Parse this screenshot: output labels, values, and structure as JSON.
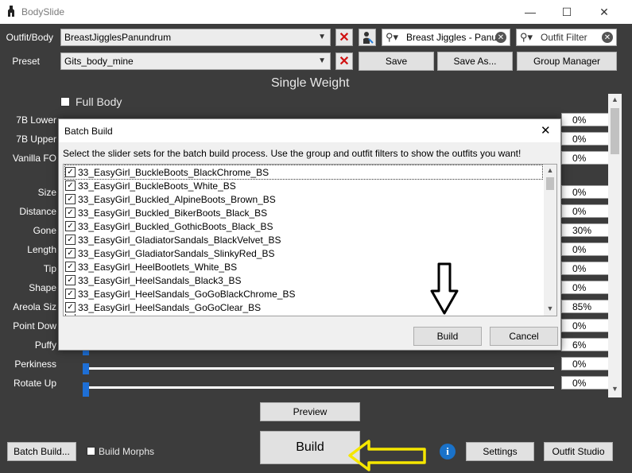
{
  "window": {
    "title": "BodySlide",
    "minimize": "—",
    "maximize": "☐",
    "close": "✕"
  },
  "outfit": {
    "label": "Outfit/Body",
    "value": "BreastJigglesPanundrum"
  },
  "preset": {
    "label": "Preset",
    "value": "Gits_body_mine"
  },
  "group_filter": {
    "value": "Breast Jiggles - Panu"
  },
  "outfit_filter": {
    "placeholder": "Outfit Filter"
  },
  "buttons": {
    "save": "Save",
    "save_as": "Save As...",
    "group_manager": "Group Manager",
    "preview": "Preview",
    "build": "Build",
    "batch_build": "Batch Build...",
    "settings": "Settings",
    "outfit_studio": "Outfit Studio"
  },
  "build_morphs": {
    "label": "Build Morphs",
    "checked": false
  },
  "weight_title": "Single Weight",
  "full_body": {
    "label": "Full Body",
    "checked": true
  },
  "sliders": [
    {
      "label": "7B Lower",
      "value": "0%"
    },
    {
      "label": "7B Upper",
      "value": "0%"
    },
    {
      "label": "Vanilla FO",
      "value": "0%"
    },
    {
      "label": "Size",
      "value": "0%"
    },
    {
      "label": "Distance",
      "value": "0%"
    },
    {
      "label": "Gone",
      "value": "30%"
    },
    {
      "label": "Length",
      "value": "0%"
    },
    {
      "label": "Tip",
      "value": "0%"
    },
    {
      "label": "Shape",
      "value": "0%"
    },
    {
      "label": "Areola Siz",
      "value": "85%"
    },
    {
      "label": "Point Dow",
      "value": "0%"
    },
    {
      "label": "Puffy",
      "value": "6%"
    },
    {
      "label": "Perkiness",
      "value": "0%"
    },
    {
      "label": "Rotate Up",
      "value": "0%"
    }
  ],
  "dialog": {
    "title": "Batch Build",
    "instructions": "Select the slider sets for the batch build process. Use the group and outfit filters to show the outfits you want!",
    "items": [
      "33_EasyGirl_BuckleBoots_BlackChrome_BS",
      "33_EasyGirl_BuckleBoots_White_BS",
      "33_EasyGirl_Buckled_AlpineBoots_Brown_BS",
      "33_EasyGirl_Buckled_BikerBoots_Black_BS",
      "33_EasyGirl_Buckled_GothicBoots_Black_BS",
      "33_EasyGirl_GladiatorSandals_BlackVelvet_BS",
      "33_EasyGirl_GladiatorSandals_SlinkyRed_BS",
      "33_EasyGirl_HeelBootlets_White_BS",
      "33_EasyGirl_HeelSandals_Black3_BS",
      "33_EasyGirl_HeelSandals_GoGoBlackChrome_BS",
      "33_EasyGirl_HeelSandals_GoGoClear_BS"
    ],
    "build": "Build",
    "cancel": "Cancel",
    "close": "✕"
  },
  "colors": {
    "background": "#3c3c3c",
    "slider_thumb": "#1e6fd6",
    "annotation_arrow": "#f5e600",
    "remove_x": "#d01010"
  }
}
